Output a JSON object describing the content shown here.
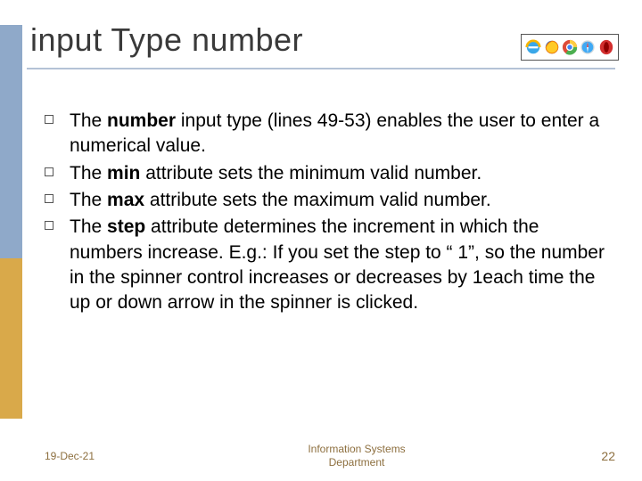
{
  "title": "input Type number",
  "bullets": [
    {
      "pre": "The ",
      "b": "number",
      "post": " input type (lines 49-53) enables the user to enter a numerical value."
    },
    {
      "pre": "The ",
      "b": "min",
      "post": " attribute sets the minimum valid number."
    },
    {
      "pre": "The ",
      "b": "max",
      "post": " attribute sets the maximum valid number."
    },
    {
      "pre": "The ",
      "b": "step",
      "post": " attribute determines the increment in which the numbers increase. E.g.: If you set the step to “ 1”, so the number in the spinner control increases or decreases by 1each time the up or down arrow in the spinner is clicked."
    }
  ],
  "footer": {
    "date": "19-Dec-21",
    "dept_line1": "Information Systems",
    "dept_line2": "Department",
    "page": "22"
  }
}
